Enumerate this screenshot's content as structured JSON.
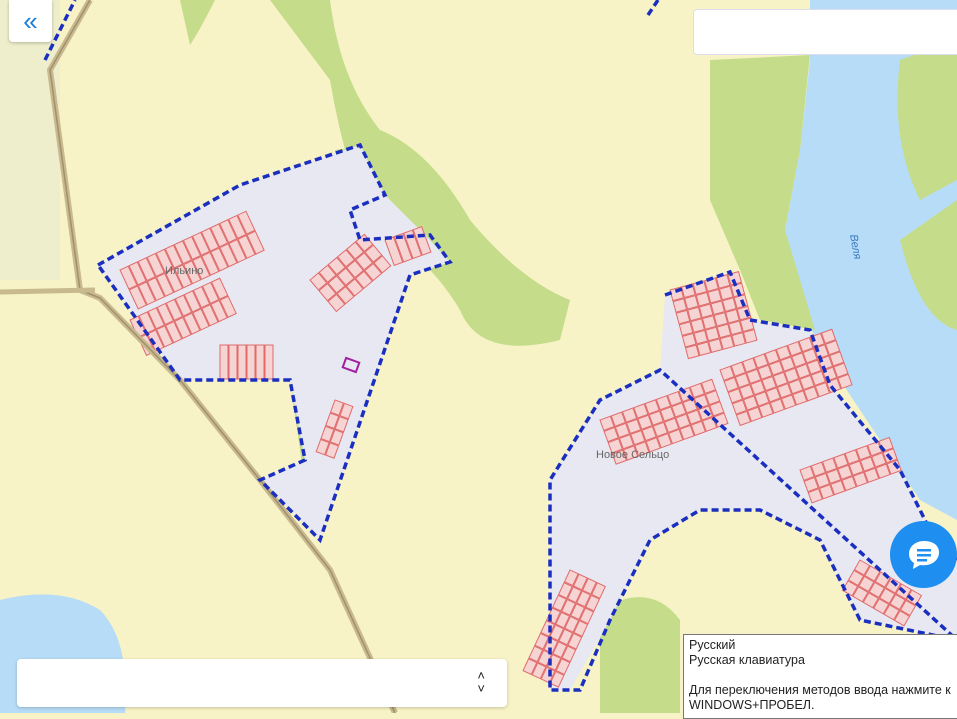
{
  "map": {
    "labels": {
      "village_1": "Ильино",
      "village_2": "Новое Сельцо",
      "lake": "Веля"
    },
    "colors": {
      "land": "#f7f3c6",
      "forest": "#c5dc8a",
      "water": "#b7dcf7",
      "settlement": "#e8e8f2",
      "boundary": "#1a2fc0",
      "parcel_fill": "#f6d4d4",
      "parcel_stroke": "#e06a6a"
    }
  },
  "controls": {
    "collapse_icon": "«",
    "chevron_up": "˄",
    "chevron_down": "˅"
  },
  "ime_popup": {
    "language": "Русский",
    "layout": "Русская клавиатура",
    "hint_line1": "Для переключения методов ввода нажмите к",
    "hint_line2": "WINDOWS+ПРОБЕЛ."
  }
}
